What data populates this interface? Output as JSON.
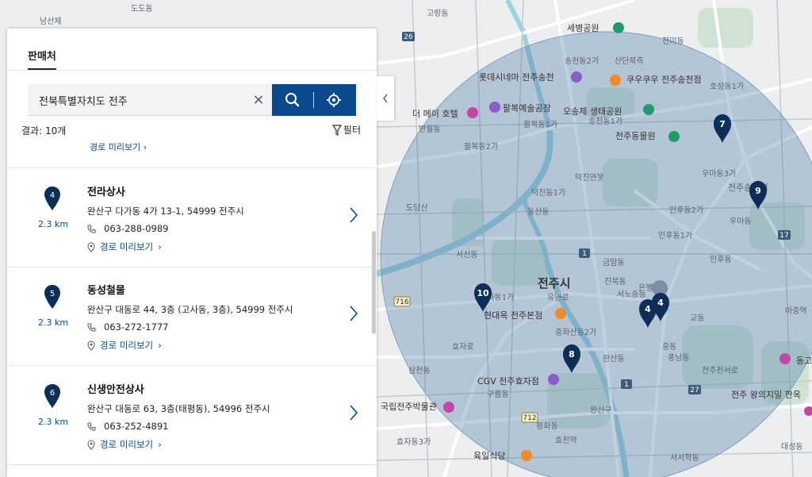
{
  "panel": {
    "tab_label": "판매처",
    "search": {
      "value": "전북특별자치도 전주",
      "clear_icon": "close-icon",
      "search_icon": "search-icon",
      "locate_icon": "crosshair-icon"
    },
    "result_count": "결과: 10개",
    "filter_label": "필터",
    "partial_route_label": "경로 미리보기  ›",
    "results": [
      {
        "number": "4",
        "distance": "2.3 km",
        "name": "전라상사",
        "address": "완산구 다가동 4가 13-1, 54999 전주시",
        "phone": "063-288-0989",
        "route_label": "경로 미리보기",
        "route_chevron": "›"
      },
      {
        "number": "5",
        "distance": "2.3 km",
        "name": "동성철물",
        "address": "완산구 대동로 44, 3층 (고사동, 3층), 54999 전주시",
        "phone": "063-272-1777",
        "route_label": "경로 미리보기",
        "route_chevron": "›"
      },
      {
        "number": "6",
        "distance": "2.3 km",
        "name": "신생안전상사",
        "address": "완산구 대동로 63, 3층(태평동), 54996 전주시",
        "phone": "063-252-4891",
        "route_label": "경로 미리보기",
        "route_chevron": "›"
      }
    ]
  },
  "map": {
    "city_label": "전주시",
    "labels": {
      "l1": "남산제",
      "l2": "도도동",
      "l3": "고랑동",
      "l4": "세병공원",
      "l5": "송천동2가",
      "l6": "산단북측",
      "l7": "롯데시네마 전주송천",
      "l8": "쿠우쿠우 전주송천점",
      "l9": "더 메이 호텔",
      "l10": "팔복예술공장",
      "l11": "오송제 생태공원",
      "l12": "전주동물원",
      "l13": "전주송천역",
      "l14": "호성동1가",
      "l15": "덕진연못",
      "l16": "우아동3가",
      "l17": "인후동2가",
      "l18": "인후동1가",
      "l19": "전주시",
      "l20": "유연로",
      "l21": "현대옥 전주본점",
      "l22": "서신동",
      "l23": "효자로",
      "l24": "CGV 전주효자점",
      "l25": "국립전주박물관",
      "l26": "효자동3가",
      "l27": "육일식당",
      "l28": "중화산동2가",
      "l29": "서서학동",
      "l30": "전주 왕의지밀 한옥",
      "l31": "동고",
      "l32": "전주천서로",
      "l33": "아중역",
      "l34": "반월동",
      "l35": "팔복동2가",
      "l36": "팔복동1가",
      "l37": "덕진동1가",
      "l38": "전미동",
      "l39": "완산구",
      "l40": "삼천동",
      "l41": "송천동1가",
      "l42": "인후동",
      "l43": "금암동",
      "l44": "우아동",
      "l45": "은행로",
      "l46": "교동",
      "l47": "대성동",
      "l48": "평화동",
      "l49": "동산동",
      "l50": "중동",
      "l51": "효자동1가",
      "l52": "서노송동",
      "l53": "진북동",
      "l54": "풍남동",
      "l55": "완산동",
      "l56": "도당산",
      "l57": "구름동",
      "l58": "효천역"
    },
    "road_numbers": [
      "26",
      "17",
      "1",
      "27",
      "716",
      "712",
      "1"
    ],
    "markers": [
      "4",
      "4",
      "7",
      "8",
      "9",
      "10"
    ]
  }
}
